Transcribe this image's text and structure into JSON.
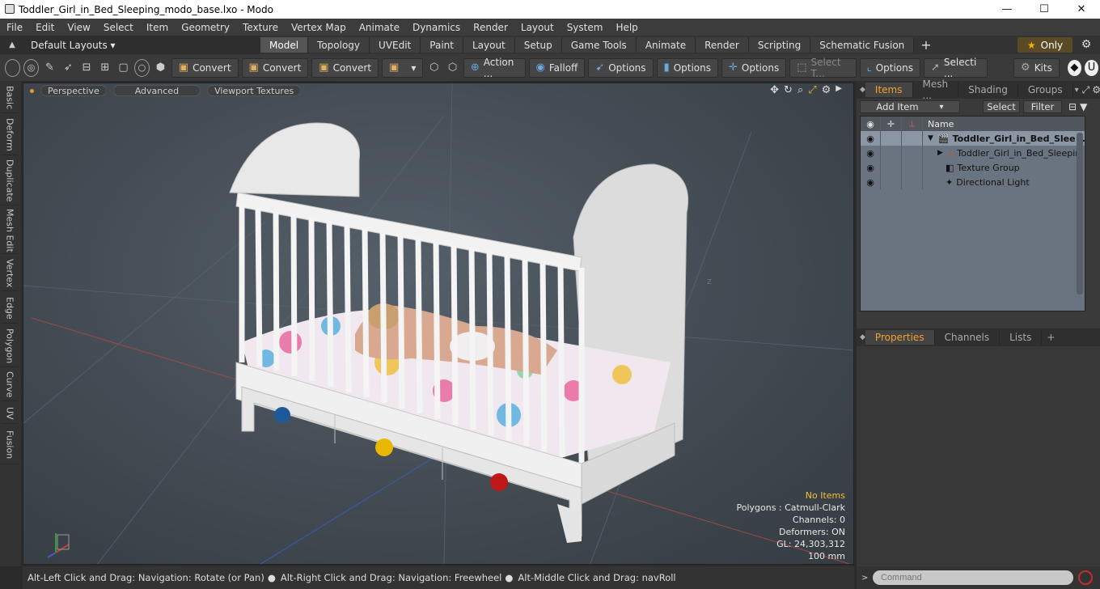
{
  "window": {
    "title": "Toddler_Girl_in_Bed_Sleeping_modo_base.lxo - Modo",
    "min": "—",
    "max": "☐",
    "close": "✕"
  },
  "menu": [
    "File",
    "Edit",
    "View",
    "Select",
    "Item",
    "Geometry",
    "Texture",
    "Vertex Map",
    "Animate",
    "Dynamics",
    "Render",
    "Layout",
    "System",
    "Help"
  ],
  "layouts": {
    "label": "Default Layouts ▾"
  },
  "tabs": [
    "Model",
    "Topology",
    "UVEdit",
    "Paint",
    "Layout",
    "Setup",
    "Game Tools",
    "Animate",
    "Render",
    "Scripting",
    "Schematic Fusion"
  ],
  "active_tab": "Model",
  "only_label": "Only",
  "toolbar": {
    "convert1": "Convert",
    "convert2": "Convert",
    "convert3": "Convert",
    "action": "Action ...",
    "falloff": "Falloff",
    "options1": "Options",
    "options2": "Options",
    "options3": "Options",
    "select_t": "Select T...",
    "options4": "Options",
    "select_i": "Selecti ...",
    "kits": "Kits"
  },
  "left_tabs": [
    "Basic",
    "Deform",
    "Duplicate",
    "Mesh Edit",
    "Vertex",
    "Edge",
    "Polygon",
    "Curve",
    "UV",
    "Fusion"
  ],
  "viewport": {
    "perspective": "Perspective",
    "advanced": "Advanced",
    "textures": "Viewport Textures",
    "axis_z": "z",
    "info": {
      "no_items": "No Items",
      "polygons": "Polygons : Catmull-Clark",
      "channels": "Channels: 0",
      "deformers": "Deformers: ON",
      "gl": "GL: 24,303,312",
      "scale": "100 mm"
    }
  },
  "status": {
    "s1": "Alt-Left Click and Drag: Navigation: Rotate (or Pan)",
    "s2": "Alt-Right Click and Drag: Navigation: Freewheel",
    "s3": "Alt-Middle Click and Drag: navRoll"
  },
  "right_panel": {
    "tabs": [
      "Items",
      "Mesh ...",
      "Shading",
      "Groups"
    ],
    "add_item": "Add Item",
    "select": "Select",
    "filter": "Filter",
    "name_col": "Name",
    "items": [
      {
        "name": "Toddler_Girl_in_Bed_Slee ...",
        "bold": true
      },
      {
        "name": "Toddler_Girl_in_Bed_Sleepin ..."
      },
      {
        "name": "Texture Group"
      },
      {
        "name": "Directional Light"
      }
    ],
    "tabs2": [
      "Properties",
      "Channels",
      "Lists"
    ],
    "command_placeholder": "Command"
  }
}
